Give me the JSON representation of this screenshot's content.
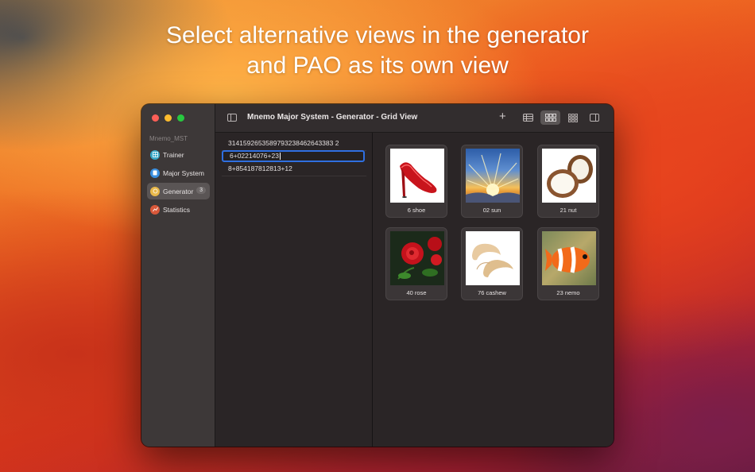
{
  "headline": {
    "line1": "Select alternative views in the generator",
    "line2": "and PAO as its own view"
  },
  "window": {
    "title": "Mnemo Major System - Generator - Grid View",
    "sidebar": {
      "section": "Mnemo_MST",
      "items": [
        {
          "label": "Trainer",
          "icon": "trainer-icon"
        },
        {
          "label": "Major System",
          "icon": "book-icon"
        },
        {
          "label": "Generator",
          "icon": "generator-icon",
          "badge": "3",
          "active": true
        },
        {
          "label": "Statistics",
          "icon": "chart-icon"
        }
      ]
    },
    "toolbar": {
      "add_label": "+",
      "views": [
        "table-view",
        "grid-view",
        "compact-grid-view"
      ],
      "active_view": "grid-view"
    },
    "list": [
      {
        "value": "3141592653589793238462643383 2"
      },
      {
        "value": "6+02214076+23",
        "editing": true
      },
      {
        "value": "8+854187812813+12"
      }
    ],
    "grid": [
      {
        "caption": "6 shoe",
        "image": "red-high-heel-shoe"
      },
      {
        "caption": "02 sun",
        "image": "sunburst-over-clouds"
      },
      {
        "caption": "21 nut",
        "image": "split-coconut"
      },
      {
        "caption": "40 rose",
        "image": "red-roses"
      },
      {
        "caption": "76 cashew",
        "image": "cashew-nuts"
      },
      {
        "caption": "23 nemo",
        "image": "clownfish"
      }
    ]
  }
}
